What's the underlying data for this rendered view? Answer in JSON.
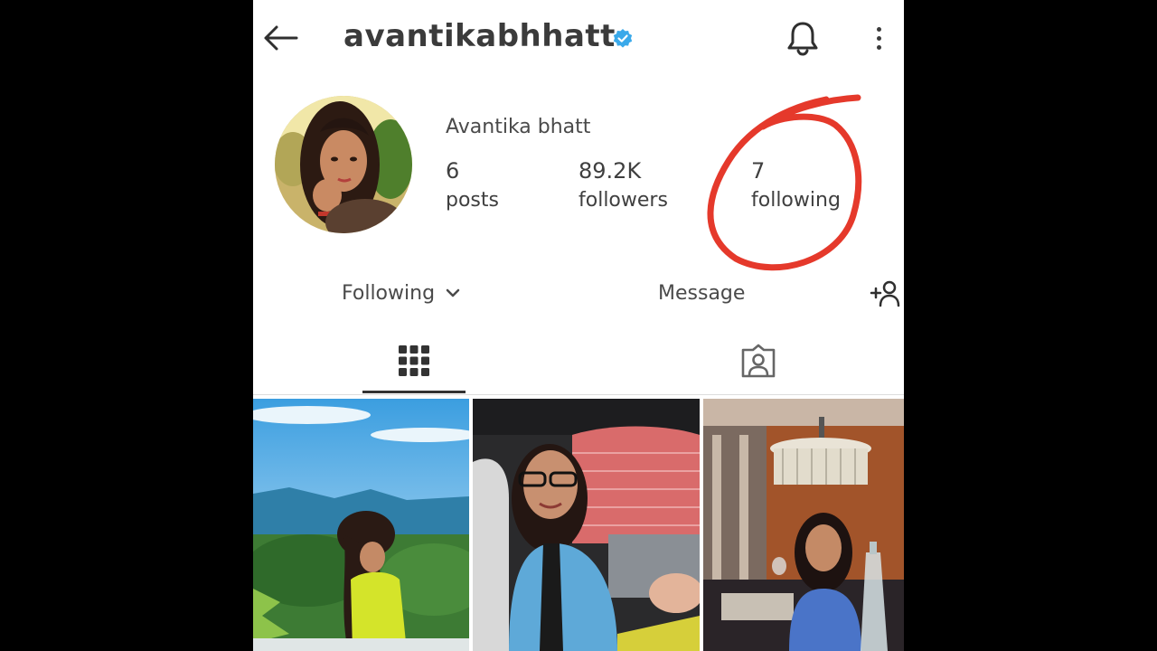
{
  "header": {
    "username": "avantikabhhatt",
    "icons": [
      "back-arrow-icon",
      "verified-badge-icon",
      "bell-icon",
      "more-vertical-icon"
    ]
  },
  "profile": {
    "full_name": "Avantika bhatt",
    "stats": {
      "posts": {
        "value": "6",
        "label": "posts"
      },
      "followers": {
        "value": "89.2K",
        "label": "followers"
      },
      "following": {
        "value": "7",
        "label": "following"
      }
    }
  },
  "actions": {
    "following_label": "Following",
    "message_label": "Message"
  },
  "tabs": [
    {
      "icon": "grid-icon",
      "active": true
    },
    {
      "icon": "tagged-person-icon",
      "active": false
    }
  ],
  "colors": {
    "annotation": "#e5392b",
    "verified": "#3aa9ea",
    "text": "#3b3b3b"
  }
}
